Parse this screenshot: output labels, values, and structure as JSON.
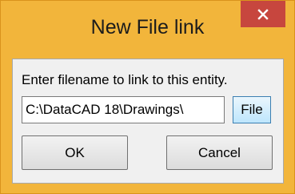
{
  "window": {
    "title": "New File link",
    "close_icon": "close-icon",
    "accent_color": "#f2b53b",
    "close_color": "#c7463e"
  },
  "dialog": {
    "prompt": "Enter filename to link to this entity.",
    "filename_value": "C:\\DataCAD 18\\Drawings\\",
    "file_button_label": "File",
    "ok_label": "OK",
    "cancel_label": "Cancel"
  }
}
